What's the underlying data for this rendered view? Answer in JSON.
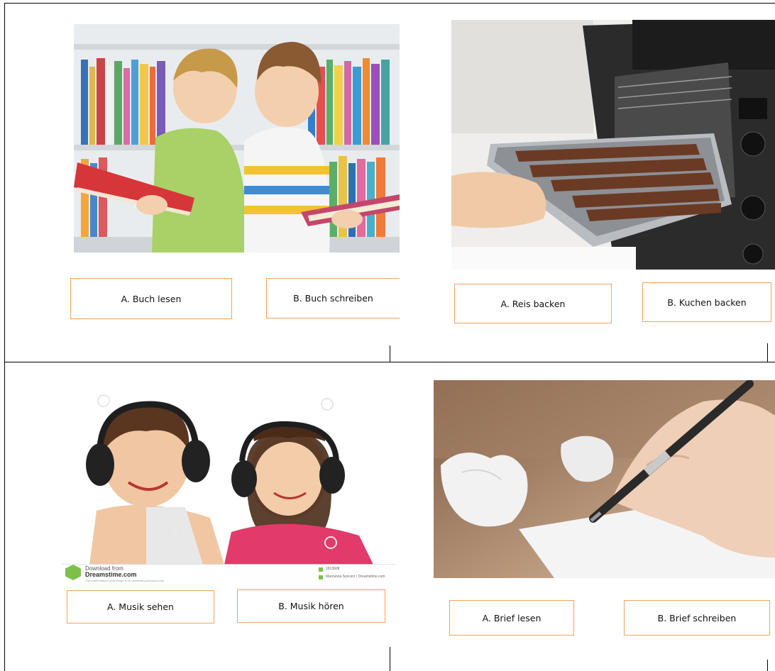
{
  "exercises": [
    {
      "option_a": "A. Buch lesen",
      "option_b": "B. Buch schreiben"
    },
    {
      "option_a": "A. Reis backen",
      "option_b": "B. Kuchen backen"
    },
    {
      "option_a": "A. Musik sehen",
      "option_b": "B. Musik hören"
    },
    {
      "option_a": "A. Brief lesen",
      "option_b": "B. Brief schreiben"
    }
  ],
  "watermark": {
    "download_from": "Download from",
    "site": "Dreamstime.com",
    "small_note": "This watermarked comp image is for previewing purposes only.",
    "image_id": "1613608",
    "credit": "Marzanna Syncerz | Dreamstime.com"
  },
  "colors": {
    "choice_border": "#f0a35e",
    "grid_line": "#000000"
  }
}
